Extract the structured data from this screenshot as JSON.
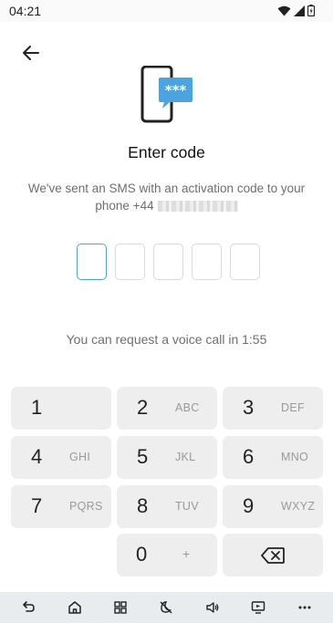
{
  "status_bar": {
    "time": "04:21"
  },
  "header": {
    "back_icon": "arrow-left-icon"
  },
  "hero": {
    "icon": "phone-sms-icon",
    "bubble_text": "***",
    "accent": "#4ba3e0"
  },
  "title": "Enter code",
  "subtitle": {
    "line": "We've sent an SMS with an activation code to your",
    "phone_prefix": "phone +44"
  },
  "code": {
    "boxes": 5,
    "active_index": 0
  },
  "voice_note": "You can request a voice call in 1:55",
  "keypad": {
    "keys": [
      {
        "num": "1",
        "letters": ""
      },
      {
        "num": "2",
        "letters": "ABC"
      },
      {
        "num": "3",
        "letters": "DEF"
      },
      {
        "num": "4",
        "letters": "GHI"
      },
      {
        "num": "5",
        "letters": "JKL"
      },
      {
        "num": "6",
        "letters": "MNO"
      },
      {
        "num": "7",
        "letters": "PQRS"
      },
      {
        "num": "8",
        "letters": "TUV"
      },
      {
        "num": "9",
        "letters": "WXYZ"
      },
      {
        "num": "0",
        "letters": "+"
      }
    ],
    "backspace_icon": "backspace-icon"
  },
  "nav_bar": {
    "icons": [
      "back-icon",
      "home-icon",
      "apps-grid-icon",
      "do-not-disturb-icon",
      "volume-icon",
      "screen-cast-icon",
      "more-icon"
    ]
  }
}
